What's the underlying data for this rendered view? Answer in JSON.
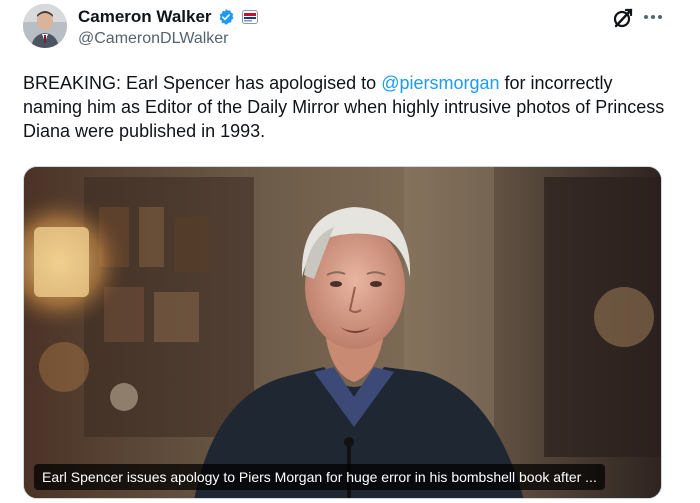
{
  "tweet": {
    "author": {
      "display_name": "Cameron Walker",
      "handle": "@CameronDLWalker",
      "avatar_icon": "profile-avatar",
      "verified_icon": "verified-badge-icon",
      "affiliate_icon": "affiliation-badge-icon"
    },
    "text": {
      "before_mention": "BREAKING: Earl Spencer has apologised to ",
      "mention": "@piersmorgan",
      "after_mention": " for incorrectly naming him as Editor of the Daily Mirror when highly intrusive photos of Princess Diana were published in 1993."
    },
    "media": {
      "caption": "Earl Spencer issues apology to Piers Morgan for huge error in his bombshell book after ..."
    },
    "actions": {
      "grok_icon": "grok-icon",
      "more_icon": "more-options-icon"
    }
  },
  "colors": {
    "link": "#1d9bf0",
    "verified": "#1d9bf0",
    "secondary_text": "#536471",
    "primary_text": "#0f1419"
  }
}
